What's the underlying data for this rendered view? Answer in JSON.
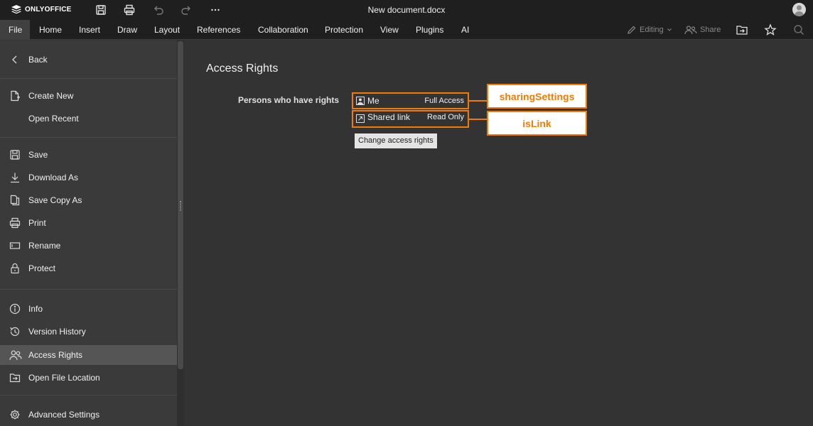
{
  "app": {
    "logo_text": "ONLYOFFICE",
    "document_title": "New document.docx"
  },
  "toolbar": {
    "icons": [
      "save-icon",
      "print-icon",
      "undo-icon",
      "redo-icon",
      "more-icon"
    ]
  },
  "menu": {
    "tabs": [
      "File",
      "Home",
      "Insert",
      "Draw",
      "Layout",
      "References",
      "Collaboration",
      "Protection",
      "View",
      "Plugins",
      "AI"
    ],
    "active_tab": "File",
    "editing_label": "Editing",
    "share_label": "Share"
  },
  "sidebar": {
    "items": [
      {
        "label": "Back",
        "icon": "chevron-left-icon"
      },
      {
        "label": "Create New",
        "icon": "new-document-icon"
      },
      {
        "label": "Open Recent",
        "icon": ""
      },
      {
        "label": "Save",
        "icon": "save-icon"
      },
      {
        "label": "Download As",
        "icon": "download-icon"
      },
      {
        "label": "Save Copy As",
        "icon": "copy-icon"
      },
      {
        "label": "Print",
        "icon": "print-icon"
      },
      {
        "label": "Rename",
        "icon": "rename-icon"
      },
      {
        "label": "Protect",
        "icon": "lock-icon"
      },
      {
        "label": "Info",
        "icon": "info-icon"
      },
      {
        "label": "Version History",
        "icon": "history-icon"
      },
      {
        "label": "Access Rights",
        "icon": "users-icon"
      },
      {
        "label": "Open File Location",
        "icon": "folder-open-icon"
      },
      {
        "label": "Advanced Settings",
        "icon": "gear-icon"
      }
    ],
    "active_item": "Access Rights"
  },
  "access_rights": {
    "title": "Access Rights",
    "persons_label": "Persons who have rights",
    "rows": [
      {
        "name": "Me",
        "access": "Full Access",
        "icon": "user-icon"
      },
      {
        "name": "Shared link",
        "access": "Read Only",
        "icon": "link-icon"
      }
    ],
    "change_button": "Change access rights"
  },
  "callouts": [
    "sharingSettings",
    "isLink"
  ],
  "colors": {
    "accent": "#f27b06",
    "chrome": "#1f1f1f",
    "sidebar": "#3a3a3a",
    "background": "#333333"
  }
}
